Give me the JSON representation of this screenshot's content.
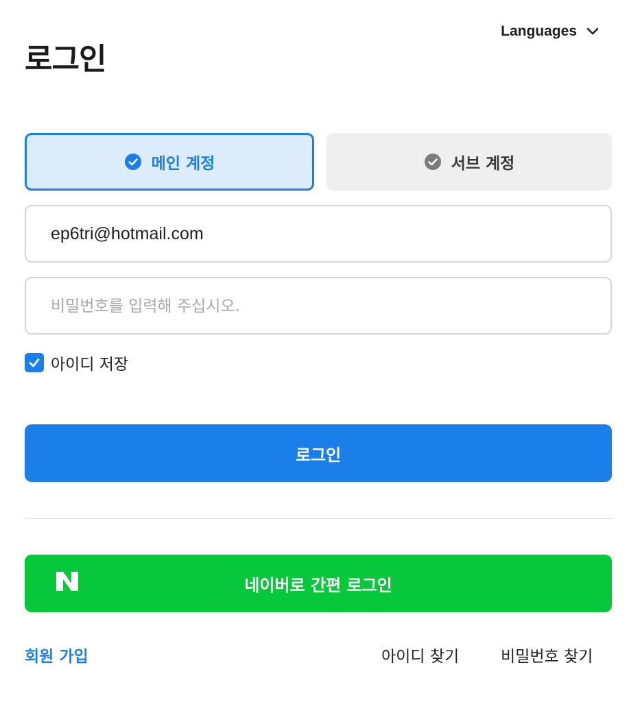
{
  "header": {
    "languages_label": "Languages",
    "title": "로그인"
  },
  "tabs": [
    {
      "label": "메인 계정",
      "active": true
    },
    {
      "label": "서브 계정",
      "active": false
    }
  ],
  "form": {
    "email_value": "ep6tri@hotmail.com",
    "password_placeholder": "비밀번호를 입력해 주십시오.",
    "remember_label": "아이디 저장",
    "remember_checked": true,
    "login_button": "로그인",
    "naver_button": "네이버로 간편 로그인"
  },
  "footer": {
    "signup": "회원 가입",
    "find_id": "아이디 찾기",
    "find_password": "비밀번호 찾기"
  },
  "colors": {
    "primary": "#1a7fe8",
    "naver_green": "#07c73b",
    "active_tab_bg": "#dcecfb",
    "inactive_tab_bg": "#efefef"
  }
}
